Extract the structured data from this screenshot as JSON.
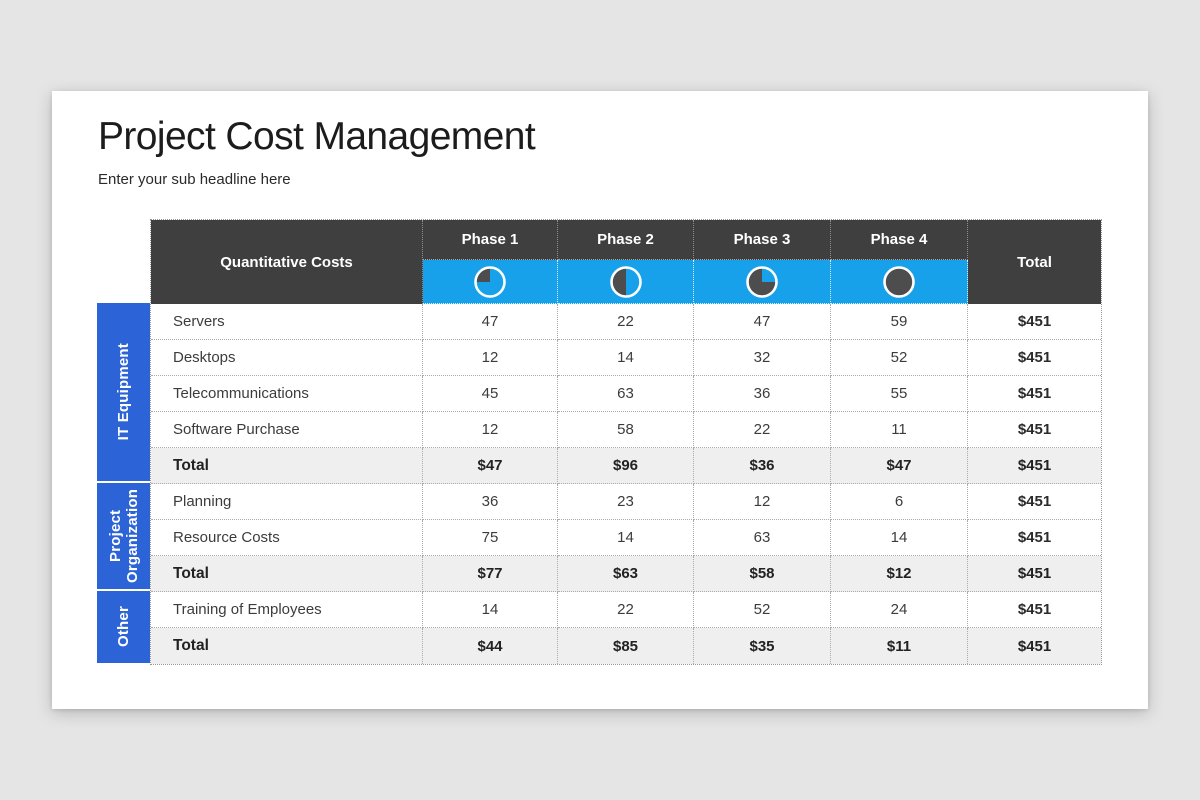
{
  "slide": {
    "title": "Project Cost Management",
    "subtitle": "Enter your sub headline here"
  },
  "colors": {
    "accent_blue": "#16a1ea",
    "sidebar_blue": "#2c64d8",
    "header_dark": "#3f3f3f",
    "total_row_bg": "#efefef",
    "pie_fill": "#4d4d4d",
    "background_gray": "#e6e5e5"
  },
  "table": {
    "corner_header": "Quantitative Costs",
    "total_header": "Total",
    "phases": [
      {
        "label": "Phase 1",
        "pie_percent": 25
      },
      {
        "label": "Phase 2",
        "pie_percent": 50
      },
      {
        "label": "Phase 3",
        "pie_percent": 75
      },
      {
        "label": "Phase 4",
        "pie_percent": 100
      }
    ],
    "groups": [
      {
        "label": "IT Equipment",
        "rows": [
          {
            "label": "Servers",
            "values": [
              "47",
              "22",
              "47",
              "59"
            ],
            "total": "$451",
            "is_total": false
          },
          {
            "label": "Desktops",
            "values": [
              "12",
              "14",
              "32",
              "52"
            ],
            "total": "$451",
            "is_total": false
          },
          {
            "label": "Telecommunications",
            "values": [
              "45",
              "63",
              "36",
              "55"
            ],
            "total": "$451",
            "is_total": false
          },
          {
            "label": "Software Purchase",
            "values": [
              "12",
              "58",
              "22",
              "11"
            ],
            "total": "$451",
            "is_total": false
          },
          {
            "label": "Total",
            "values": [
              "$47",
              "$96",
              "$36",
              "$47"
            ],
            "total": "$451",
            "is_total": true
          }
        ]
      },
      {
        "label": "Project Organization",
        "rows": [
          {
            "label": "Planning",
            "values": [
              "36",
              "23",
              "12",
              "6"
            ],
            "total": "$451",
            "is_total": false
          },
          {
            "label": "Resource Costs",
            "values": [
              "75",
              "14",
              "63",
              "14"
            ],
            "total": "$451",
            "is_total": false
          },
          {
            "label": "Total",
            "values": [
              "$77",
              "$63",
              "$58",
              "$12"
            ],
            "total": "$451",
            "is_total": true
          }
        ]
      },
      {
        "label": "Other",
        "rows": [
          {
            "label": "Training of Employees",
            "values": [
              "14",
              "22",
              "52",
              "24"
            ],
            "total": "$451",
            "is_total": false
          },
          {
            "label": "Total",
            "values": [
              "$44",
              "$85",
              "$35",
              "$11"
            ],
            "total": "$451",
            "is_total": true
          }
        ]
      }
    ]
  }
}
